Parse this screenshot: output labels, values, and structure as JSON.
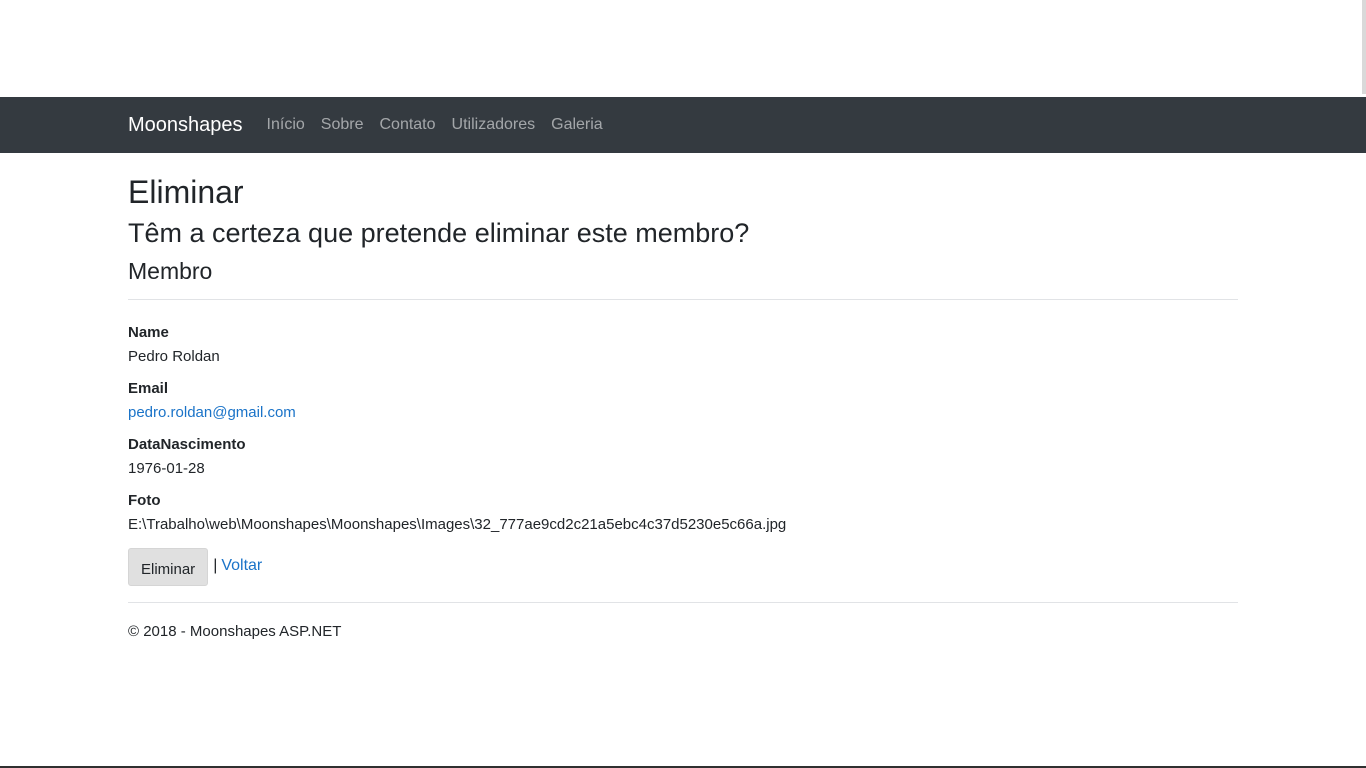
{
  "nav": {
    "brand": "Moonshapes",
    "links": [
      "Início",
      "Sobre",
      "Contato",
      "Utilizadores",
      "Galeria"
    ]
  },
  "page": {
    "title": "Eliminar",
    "question": "Têm a certeza que pretende eliminar este membro?",
    "section": "Membro"
  },
  "details": {
    "name_label": "Name",
    "name_value": "Pedro Roldan",
    "email_label": "Email",
    "email_value": "pedro.roldan@gmail.com",
    "birth_label": "DataNascimento",
    "birth_value": "1976-01-28",
    "photo_label": "Foto",
    "photo_value": "E:\\Trabalho\\web\\Moonshapes\\Moonshapes\\Images\\32_777ae9cd2c21a5ebc4c37d5230e5c66a.jpg"
  },
  "actions": {
    "delete_label": "Eliminar",
    "separator": "|",
    "back_label": "Voltar"
  },
  "footer": {
    "text": "© 2018 - Moonshapes ASP.NET"
  }
}
